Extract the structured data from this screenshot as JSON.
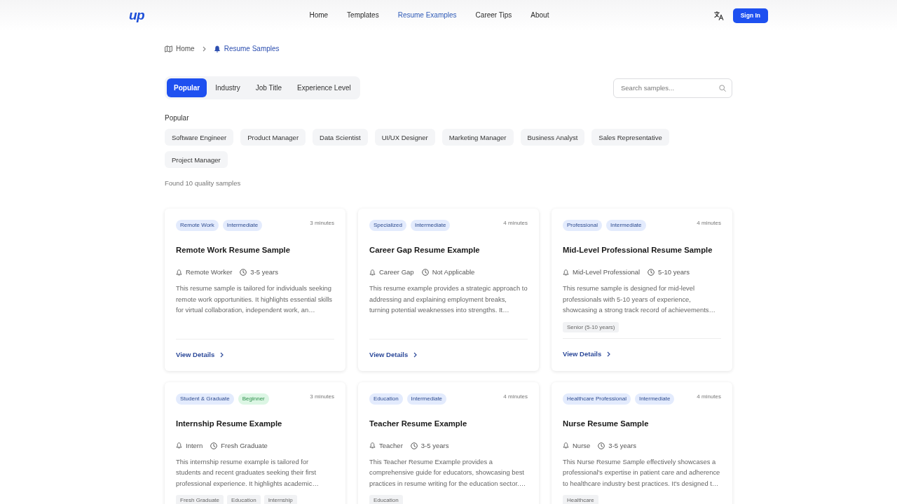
{
  "header": {
    "logo": "up",
    "nav": [
      {
        "label": "Home",
        "selected": false
      },
      {
        "label": "Templates",
        "selected": false
      },
      {
        "label": "Resume Examples",
        "selected": true
      },
      {
        "label": "Career Tips",
        "selected": false
      },
      {
        "label": "About",
        "selected": false
      }
    ],
    "sign_in": "Sign In"
  },
  "breadcrumb": [
    {
      "label": "Home",
      "selected": false
    },
    {
      "label": "Resume Samples",
      "selected": true
    }
  ],
  "filter_tabs": [
    {
      "label": "Popular",
      "selected": true
    },
    {
      "label": "Industry",
      "selected": false
    },
    {
      "label": "Job Title",
      "selected": false
    },
    {
      "label": "Experience Level",
      "selected": false
    }
  ],
  "search": {
    "placeholder": "Search samples..."
  },
  "popular": {
    "label": "Popular",
    "chips": [
      "Software Engineer",
      "Product Manager",
      "Data Scientist",
      "UI/UX Designer",
      "Marketing Manager",
      "Business Analyst",
      "Sales Representative",
      "Project Manager"
    ]
  },
  "result_count": "Found 10 quality samples",
  "cards": [
    {
      "tags": [
        {
          "label": "Remote Work",
          "color": "#e3ebfd"
        },
        {
          "label": "Intermediate",
          "color": "#e3ebfd"
        }
      ],
      "read_time": "3 minutes",
      "title": "Remote Work Resume Sample",
      "role": "Remote Worker",
      "experience": "3-5 years",
      "description": "This resume sample is tailored for individuals seeking remote work opportunities. It highlights essential skills for virtual collaboration, independent work, an…",
      "link": "View Details"
    },
    {
      "tags": [
        {
          "label": "Specialized",
          "color": "#e3ebfd"
        },
        {
          "label": "Intermediate",
          "color": "#e3ebfd"
        }
      ],
      "read_time": "4 minutes",
      "title": "Career Gap Resume Example",
      "role": "Career Gap",
      "experience": "Not Applicable",
      "description": "This resume example provides a strategic approach to addressing and explaining employment breaks, turning potential weaknesses into strengths. It…",
      "link": "View Details"
    },
    {
      "tags": [
        {
          "label": "Professional",
          "color": "#e3ebfd"
        },
        {
          "label": "Intermediate",
          "color": "#e3ebfd"
        }
      ],
      "read_time": "4 minutes",
      "title": "Mid-Level Professional Resume Sample",
      "role": "Mid-Level Professional",
      "experience": "5-10 years",
      "description": "This resume sample is designed for mid-level professionals with 5-10 years of experience, showcasing a strong track record of achievements…",
      "chips": [
        "Senior (5-10 years)"
      ],
      "link": "View Details"
    },
    {
      "tags": [
        {
          "label": "Student & Graduate",
          "color": "#e3ebfd"
        },
        {
          "label": "Beginner",
          "color": "#dcf6e4"
        }
      ],
      "read_time": "3 minutes",
      "title": "Internship Resume Example",
      "role": "Intern",
      "experience": "Fresh Graduate",
      "description": "This internship resume example is tailored for students and recent graduates seeking their first professional experience. It highlights academic…",
      "chips": [
        "Fresh Graduate",
        "Education",
        "Internship"
      ]
    },
    {
      "tags": [
        {
          "label": "Education",
          "color": "#e3ebfd"
        },
        {
          "label": "Intermediate",
          "color": "#e3ebfd"
        }
      ],
      "read_time": "4 minutes",
      "title": "Teacher Resume Example",
      "role": "Teacher",
      "experience": "3-5 years",
      "description": "This Teacher Resume Example provides a comprehensive guide for educators, showcasing best practices in resume writing for the education sector.…",
      "chips": [
        "Education"
      ]
    },
    {
      "tags": [
        {
          "label": "Healthcare Professional",
          "color": "#e3ebfd"
        },
        {
          "label": "Intermediate",
          "color": "#e3ebfd"
        }
      ],
      "read_time": "4 minutes",
      "title": "Nurse Resume Sample",
      "role": "Nurse",
      "experience": "3-5 years",
      "description": "This Nurse Resume Sample effectively showcases a professional's expertise in patient care and adherence to healthcare industry best practices. It's designed t…",
      "chips": [
        "Healthcare"
      ]
    }
  ]
}
